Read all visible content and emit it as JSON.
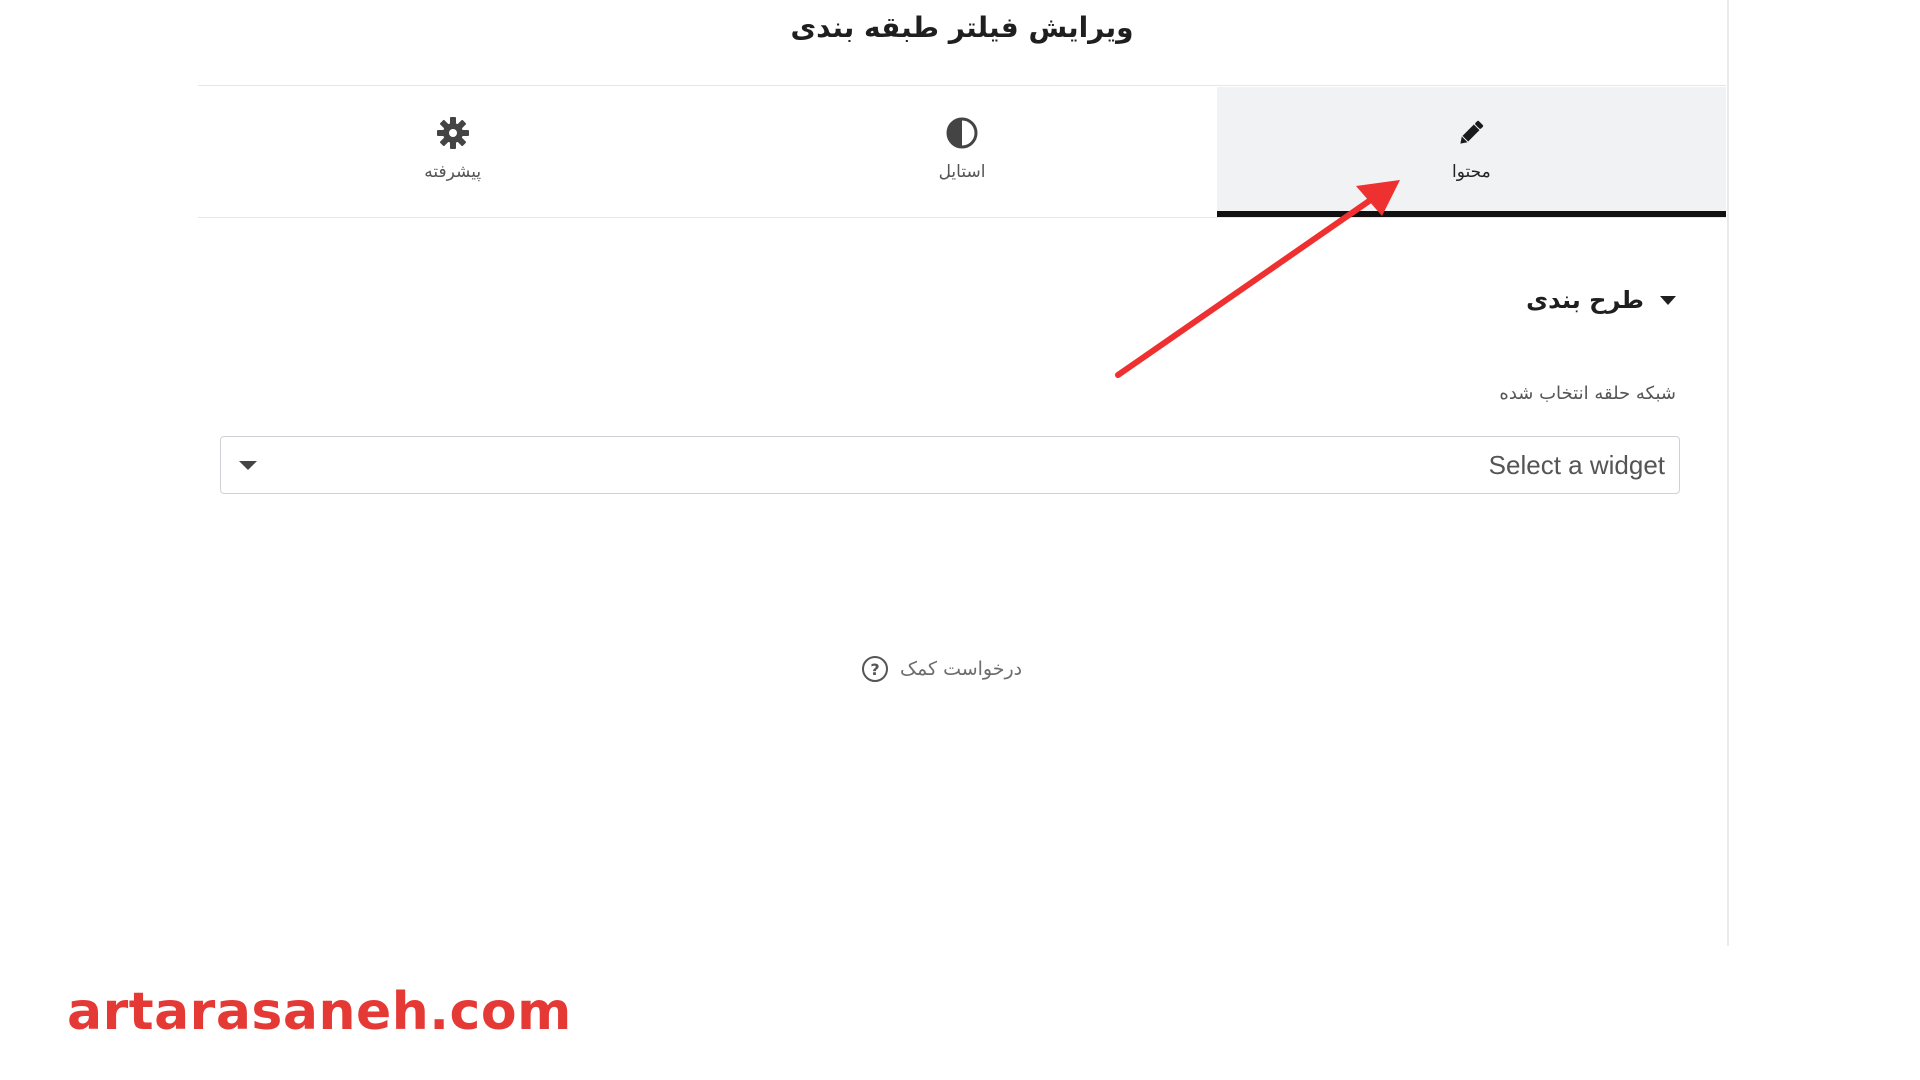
{
  "panel": {
    "title": "ویرایش فیلتر طبقه بندی"
  },
  "tabs": [
    {
      "label": "محتوا",
      "icon": "pencil-icon",
      "active": true
    },
    {
      "label": "استایل",
      "icon": "half-circle-icon",
      "active": false
    },
    {
      "label": "پیشرفته",
      "icon": "gear-icon",
      "active": false
    }
  ],
  "section": {
    "title": "طرح بندی",
    "field_label": "شبکه حلقه انتخاب شده",
    "select_value": "Select a widget"
  },
  "help": {
    "label": "درخواست کمک"
  },
  "annotation": {
    "arrow_color": "#ee3030"
  },
  "watermark": {
    "text": "artarasaneh.com",
    "color": "#e53935"
  }
}
